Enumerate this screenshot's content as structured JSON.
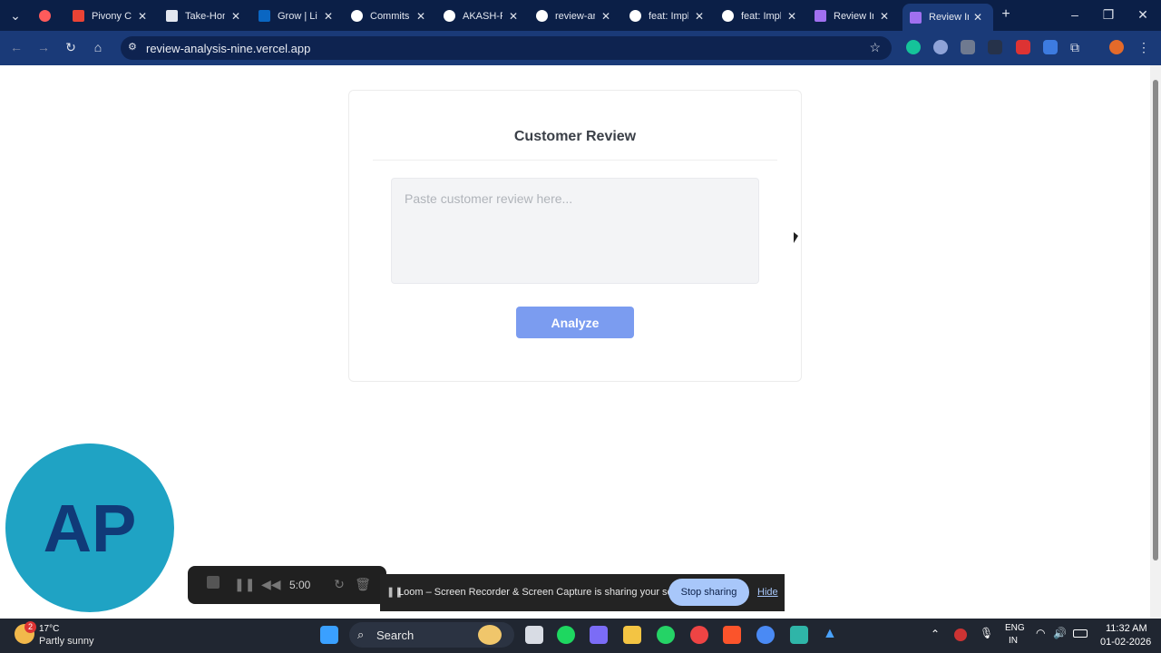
{
  "browser": {
    "tabs": [
      {
        "title": "",
        "icon": "loom-icon",
        "color": "#ff5b5b"
      },
      {
        "title": "Pivony Ca",
        "icon": "gmail-icon",
        "color": "#ea4335"
      },
      {
        "title": "Take-Hom",
        "icon": "flag-icon",
        "color": "#e3e7f0"
      },
      {
        "title": "Grow | Lin",
        "icon": "linkedin-icon",
        "color": "#0a66c2"
      },
      {
        "title": "Commits",
        "icon": "github-icon",
        "color": "#ffffff"
      },
      {
        "title": "AKASH-PI",
        "icon": "github-icon",
        "color": "#ffffff"
      },
      {
        "title": "review-an",
        "icon": "github-icon",
        "color": "#ffffff"
      },
      {
        "title": "feat: Impl",
        "icon": "github-icon",
        "color": "#ffffff"
      },
      {
        "title": "feat: Impl",
        "icon": "github-icon",
        "color": "#ffffff"
      },
      {
        "title": "Review In",
        "icon": "vercel-icon",
        "color": "#a070f0"
      },
      {
        "title": "Review In",
        "icon": "vercel-icon",
        "color": "#a070f0"
      }
    ],
    "url": "review-analysis-nine.vercel.app"
  },
  "page": {
    "title": "Customer Review",
    "input_placeholder": "Paste customer review here...",
    "analyze_label": "Analyze"
  },
  "avatar": {
    "initials": "AP"
  },
  "recorder": {
    "time": "5:00"
  },
  "loom": {
    "message": "Loom – Screen Recorder & Screen Capture is sharing your screen.",
    "stop_label": "Stop sharing",
    "hide_label": "Hide"
  },
  "taskbar": {
    "weather_temp": "17°C",
    "weather_badge": "2",
    "weather_desc": "Partly sunny",
    "search_label": "Search",
    "lang_1": "ENG",
    "lang_2": "IN",
    "time": "11:32 AM",
    "date": "01-02-2026"
  }
}
